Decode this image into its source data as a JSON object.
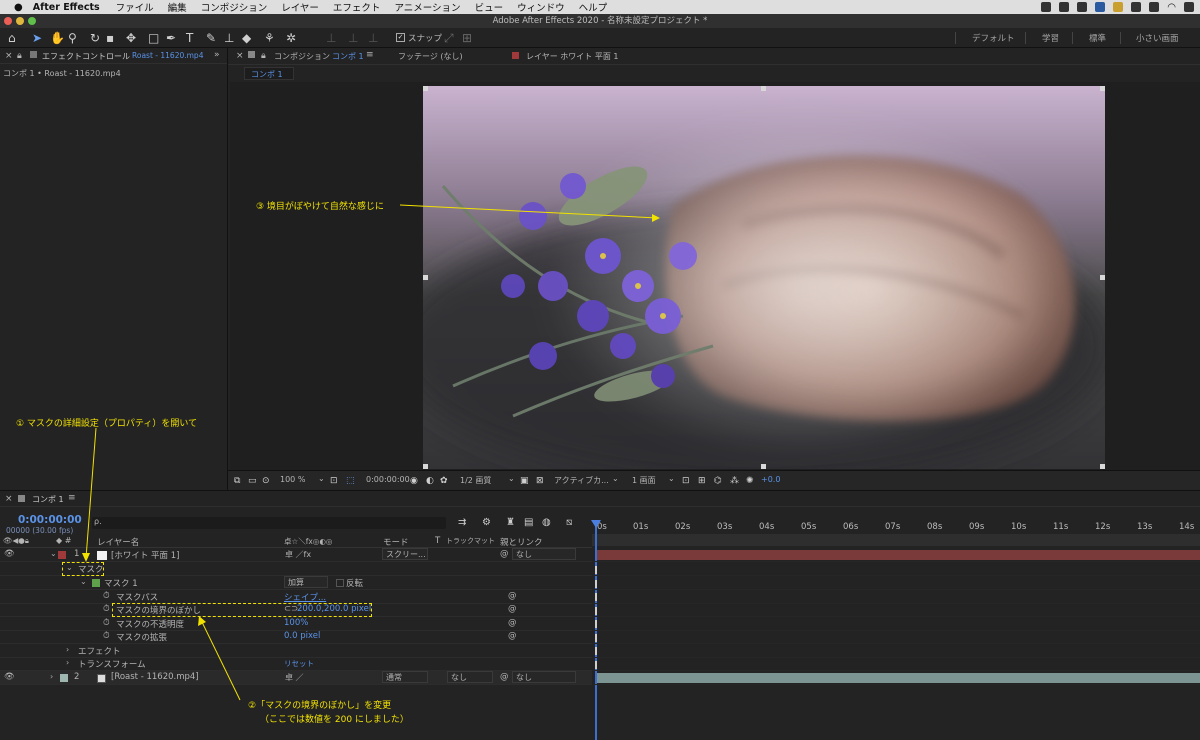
{
  "menubar": {
    "apple": "",
    "app": "After Effects",
    "items": [
      "ファイル",
      "編集",
      "コンポジション",
      "レイヤー",
      "エフェクト",
      "アニメーション",
      "ビュー",
      "ウィンドウ",
      "ヘルプ"
    ]
  },
  "window": {
    "title": "Adobe After Effects 2020 - 名称未設定プロジェクト *"
  },
  "toolbar": {
    "snap_label": "スナップ",
    "workspaces": [
      "デフォルト",
      "学習",
      "標準",
      "小さい画面"
    ]
  },
  "effects_panel": {
    "title": "エフェクトコントロール",
    "subtitle": "Roast - 11620.mp4",
    "content": "コンポ 1 • Roast - 11620.mp4"
  },
  "comp_panel": {
    "tab_prefix": "コンポジション",
    "tab_name": "コンポ 1",
    "footage_tab": "フッテージ (なし)",
    "layer_tab": "レイヤー ホワイト 平面 1",
    "sub_tab": "コンポ 1"
  },
  "viewer_bar": {
    "zoom": "100 %",
    "timecode": "0:00:00:00",
    "resolution": "1/2 画質",
    "camera": "アクティブカ...",
    "views": "1 画面",
    "exposure": "+0.0"
  },
  "timeline": {
    "tab": "コンポ 1",
    "timecode": "0:00:00:00",
    "fps": "00000 (30.00 fps)",
    "search_placeholder": "ρ.",
    "headers": {
      "layer_name": "レイヤー名",
      "mode": "モード",
      "t": "T",
      "trackmatte": "トラックマット",
      "parent": "親とリンク"
    },
    "ruler": [
      "0s",
      "01s",
      "02s",
      "03s",
      "04s",
      "05s",
      "06s",
      "07s",
      "08s",
      "09s",
      "10s",
      "11s",
      "12s",
      "13s",
      "14s"
    ],
    "layer1": {
      "num": "1",
      "name": "[ホワイト 平面 1]",
      "mode": "スクリー...",
      "parent": "なし",
      "color": "#a03a3a"
    },
    "mask_group": "マスク",
    "mask1": {
      "name": "マスク 1",
      "mode": "加算",
      "invert": "反転",
      "color": "#5fa04a"
    },
    "mask_path": {
      "name": "マスクパス",
      "value": "シェイプ..."
    },
    "mask_feather": {
      "name": "マスクの境界のぼかし",
      "value": "200.0,200.0 pixel"
    },
    "mask_opacity": {
      "name": "マスクの不透明度",
      "value": "100%"
    },
    "mask_expansion": {
      "name": "マスクの拡張",
      "value": "0.0 pixel"
    },
    "effects": "エフェクト",
    "transform": {
      "name": "トランスフォーム",
      "value": "リセット"
    },
    "layer2": {
      "num": "2",
      "name": "[Roast - 11620.mp4]",
      "mode": "通常",
      "trackmatte": "なし",
      "parent": "なし",
      "color": "#9fb5b0"
    }
  },
  "annotations": {
    "a1": "① マスクの詳細設定（プロパティ）を開いて",
    "a2_line1": "②「マスクの境界のぼかし」を変更",
    "a2_line2": "（ここでは数値を 200 にしました）",
    "a3": "③ 境目がぼやけて自然な感じに"
  },
  "colors": {
    "accent": "#5a93e8",
    "annotation": "#f2e200",
    "layer1_bar": "#7a3a3a",
    "layer2_bar": "#7d9592"
  }
}
